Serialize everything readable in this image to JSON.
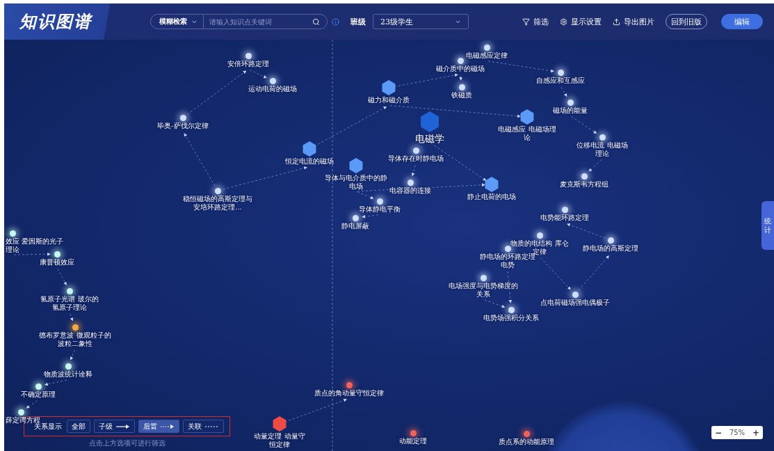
{
  "header": {
    "logo": "知识图谱",
    "search": {
      "mode": "模糊检索",
      "placeholder": "请输入知识点关键词"
    },
    "class_label": "班级",
    "class_select": "23级学生",
    "actions": [
      {
        "kind": "filter",
        "label": "筛选"
      },
      {
        "kind": "settings",
        "label": "显示设置"
      },
      {
        "kind": "export",
        "label": "导出图片"
      }
    ],
    "buttons": [
      {
        "label": "回到旧版",
        "primary": false
      },
      {
        "label": "编辑",
        "primary": true
      }
    ]
  },
  "graph": {
    "nodes": [
      {
        "label": "安倍环路定理",
        "kind": "dot",
        "color": "#cfe0ff"
      },
      {
        "label": "运动电荷的磁场",
        "kind": "dot",
        "color": "#cfe0ff"
      },
      {
        "label": "毕奥-萨伐尔定律",
        "kind": "dot",
        "color": "#cfe0ff"
      },
      {
        "label": "恒定电流的磁场",
        "kind": "hex",
        "color": "#5b9bf7"
      },
      {
        "label": "稳恒磁场的高斯定理与安培环路定理...",
        "kind": "dot",
        "color": "#cfe0ff"
      },
      {
        "label": "磁力和磁介质",
        "kind": "hex",
        "color": "#5b9bf7"
      },
      {
        "label": "电磁学",
        "kind": "hub",
        "color": "#1f63d6"
      },
      {
        "label": "电磁感应定律",
        "kind": "dot",
        "color": "#cfe0ff"
      },
      {
        "label": "磁介质中的磁场",
        "kind": "dot",
        "color": "#cfe0ff"
      },
      {
        "label": "铁磁质",
        "kind": "dot",
        "color": "#cfe0ff"
      },
      {
        "label": "自感应和互感应",
        "kind": "dot",
        "color": "#cfe0ff"
      },
      {
        "label": "磁场的能量",
        "kind": "dot",
        "color": "#cfe0ff"
      },
      {
        "label": "电磁感应 电磁场理论",
        "kind": "hex",
        "color": "#5b9bf7"
      },
      {
        "label": "位移电流 电磁场理论",
        "kind": "dot",
        "color": "#cfe0ff"
      },
      {
        "label": "麦克斯韦方程组",
        "kind": "dot",
        "color": "#cfe0ff"
      },
      {
        "label": "导体存在时静电场",
        "kind": "dot",
        "color": "#cfe0ff"
      },
      {
        "label": "导体与电介质中的静电场",
        "kind": "hex",
        "color": "#5b9bf7"
      },
      {
        "label": "电容器的连接",
        "kind": "dot",
        "color": "#cfe0ff"
      },
      {
        "label": "静止电荷的电场",
        "kind": "hex",
        "color": "#5b9bf7"
      },
      {
        "label": "导体静电平衡",
        "kind": "dot",
        "color": "#cfe0ff"
      },
      {
        "label": "静电屏蔽",
        "kind": "dot",
        "color": "#cfe0ff"
      },
      {
        "label": "电势能环路定理",
        "kind": "dot",
        "color": "#cfe0ff"
      },
      {
        "label": "物质的电结构 库仑定律",
        "kind": "dot",
        "color": "#cfe0ff"
      },
      {
        "label": "静电场的高斯定理",
        "kind": "dot",
        "color": "#cfe0ff"
      },
      {
        "label": "静电场的环路定理电势",
        "kind": "dot",
        "color": "#cfe0ff"
      },
      {
        "label": "电场强度与电势梯度的关系",
        "kind": "dot",
        "color": "#cfe0ff"
      },
      {
        "label": "点电荷磁场强电偶极子",
        "kind": "dot",
        "color": "#cfe0ff"
      },
      {
        "label": "电势场强积分关系",
        "kind": "dot",
        "color": "#cfe0ff"
      },
      {
        "label": "效应 爱因斯的光子理论",
        "kind": "dot",
        "color": "#c4f7ef"
      },
      {
        "label": "康普顿效应",
        "kind": "dot",
        "color": "#c4f7ef"
      },
      {
        "label": "氢原子光谱 玻尔的氢原子理论",
        "kind": "dot",
        "color": "#c4f7ef"
      },
      {
        "label": "德布罗意波 微观粒子的波粒二象性",
        "kind": "dot",
        "color": "#f6a93b"
      },
      {
        "label": "物质波统计诠释",
        "kind": "dot",
        "color": "#c4f7ef"
      },
      {
        "label": "不确定原理",
        "kind": "dot",
        "color": "#c4f7ef"
      },
      {
        "label": "薛定谔方程",
        "kind": "dot",
        "color": "#c4f7ef"
      },
      {
        "label": "质点的角动量守恒定律",
        "kind": "dot",
        "color": "#f0625a"
      },
      {
        "label": "动量定理 动量守恒定律",
        "kind": "hex",
        "color": "#ef4b45"
      },
      {
        "label": "动能定理",
        "kind": "dot",
        "color": "#f0625a"
      },
      {
        "label": "质点系的动能原理",
        "kind": "dot",
        "color": "#f0625a"
      }
    ]
  },
  "side_tab": "统计",
  "relations": {
    "label": "关系显示",
    "options": [
      {
        "label": "全部",
        "kind": "none",
        "selected": false
      },
      {
        "label": "子级",
        "kind": "solid",
        "selected": false
      },
      {
        "label": "后置",
        "kind": "dotted",
        "selected": true
      },
      {
        "label": "关联",
        "kind": "dashed",
        "selected": false
      }
    ],
    "hint": "点击上方选项可进行筛选"
  },
  "zoom": {
    "minus": "−",
    "value": "75%",
    "plus": "+"
  }
}
